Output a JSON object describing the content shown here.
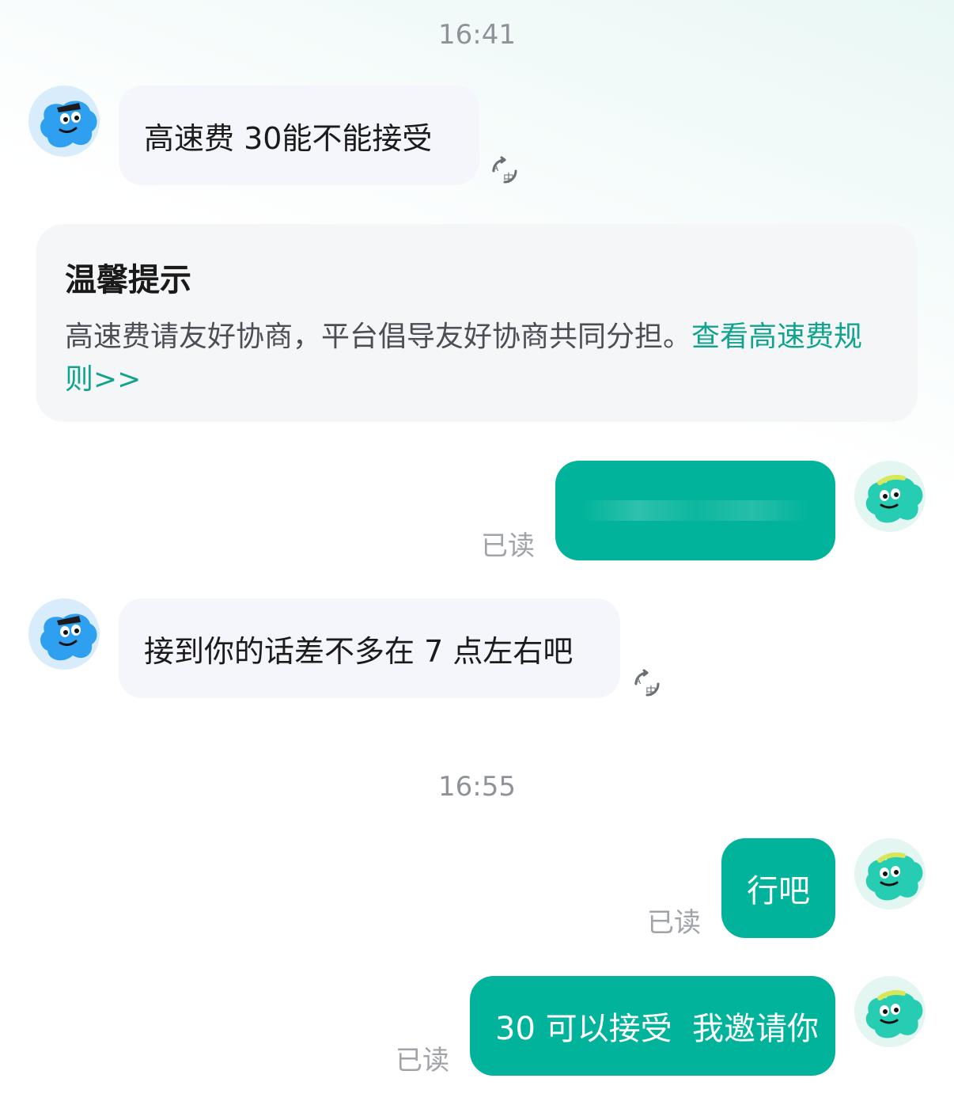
{
  "timestamps": [
    "16:41",
    "16:55"
  ],
  "messages": [
    {
      "side": "left",
      "text": "高速费 30能不能接受"
    },
    {
      "side": "right",
      "text": "",
      "status": "已读"
    },
    {
      "side": "left",
      "text": "接到你的话差不多在 7 点左右吧"
    },
    {
      "side": "right",
      "text": "行吧",
      "status": "已读"
    },
    {
      "side": "right",
      "text": "30 可以接受  我邀请你",
      "status": "已读"
    }
  ],
  "notice": {
    "title": "温馨提示",
    "body": "高速费请友好协商，平台倡导友好协商共同分担。",
    "link": "查看高速费规则>>"
  },
  "icons": {
    "other_avatar": "blue-character-with-sunglasses-icon",
    "self_avatar": "teal-character-with-headband-icon",
    "translate": "translate-icon"
  },
  "colors": {
    "self_bubble": "#00b39a",
    "other_bubble": "#f4f6fb",
    "link": "#12a38e",
    "other_avatar": "#2f9ff0",
    "self_avatar": "#27cdb2"
  }
}
